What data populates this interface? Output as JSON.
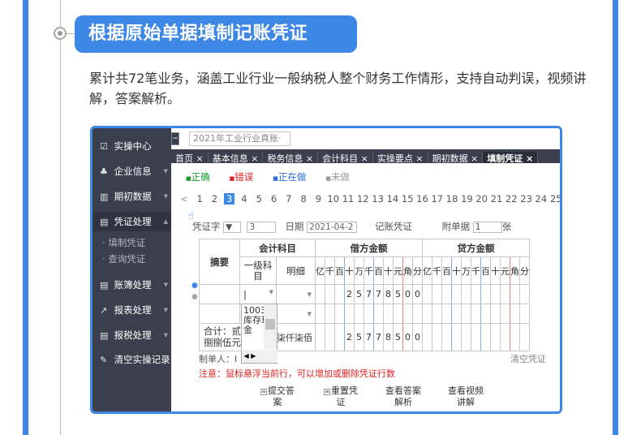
{
  "section_title": "根据原始单据填制记账凭证",
  "description": "累计共72笔业务，涵盖工业行业一般纳税人整个财务工作情形，支持自动判误，视频讲解，答案解析。",
  "colors": {
    "accent": "#3d88e6",
    "sidebar": "#3a3f4d",
    "error": "#e02020"
  },
  "app": {
    "company_select": "2021年工业行业真账·",
    "nav": {
      "items": [
        {
          "icon": "monitor-icon",
          "glyph": "☑",
          "label": "实操中心"
        },
        {
          "icon": "company-icon",
          "glyph": "♣",
          "label": "企业信息"
        },
        {
          "icon": "chart-icon",
          "glyph": "▥",
          "label": "期初数据"
        },
        {
          "icon": "voucher-icon",
          "glyph": "▤",
          "label": "凭证处理"
        },
        {
          "icon": "ledger-icon",
          "glyph": "▤",
          "label": "账簿处理"
        },
        {
          "icon": "report-icon",
          "glyph": "↗",
          "label": "报表处理"
        },
        {
          "icon": "tax-icon",
          "glyph": "▤",
          "label": "报税处理"
        },
        {
          "icon": "broom-icon",
          "glyph": "✎",
          "label": "清空实操记录"
        }
      ],
      "sub_items": [
        "填制凭证",
        "查询凭证"
      ]
    },
    "tabs": [
      "首页 ×",
      "基本信息 ×",
      "税务信息 ×",
      "会计科目 ×",
      "实操要点 ×",
      "期初数据 ×",
      "填制凭证 ×"
    ],
    "legend": [
      {
        "mark": "■",
        "label": "正确",
        "color": "#1a9a2a"
      },
      {
        "mark": "■",
        "label": "错误",
        "color": "#e02020"
      },
      {
        "mark": "■",
        "label": "正在做",
        "color": "#2a6fdb"
      },
      {
        "mark": "■",
        "label": "未做",
        "color": "#999999"
      }
    ],
    "pager": {
      "prev": "<",
      "pages": [
        "1",
        "2",
        "3",
        "4",
        "5",
        "6",
        "7",
        "8",
        "9",
        "10",
        "11",
        "12",
        "13",
        "14",
        "15",
        "16",
        "17",
        "18",
        "19",
        "20",
        "21",
        "22",
        "23",
        "24",
        "25"
      ],
      "current": "3"
    },
    "voucher": {
      "word_label": "凭证字",
      "word_arrow": "▼",
      "number": "3",
      "date_label": "日期",
      "date_value": "2021-04-2",
      "title": "记账凭证",
      "attach_label": "附单据",
      "attach_value": "1",
      "attach_unit": "张",
      "col_summary": "摘要",
      "col_account": "会计科目",
      "col_level1": "一级科目",
      "col_detail": "明细",
      "col_debit": "借方金额",
      "col_credit": "贷方金额",
      "digit_units": [
        "亿",
        "千",
        "百",
        "十",
        "万",
        "千",
        "百",
        "十",
        "元",
        "角",
        "分"
      ],
      "row1_debit_digits": [
        "",
        "",
        "",
        "2",
        "5",
        "7",
        "7",
        "8",
        "5",
        "0",
        "0"
      ],
      "total_debit_digits": [
        "",
        "",
        "",
        "2",
        "5",
        "7",
        "7",
        "8",
        "5",
        "0",
        "0"
      ],
      "dropdown_text": "1003-库存现金",
      "total_label": "合计：贰捌捌伍元",
      "total_words_right": "柒仟柒佰",
      "maker_label": "制单人：I",
      "clear_label": "清空凭证",
      "notice": "注意：鼠标悬浮当前行，可以增加或删除凭证行数"
    },
    "buttons": [
      "提交答案",
      "重置凭证",
      "查看答案解析",
      "查看视频讲解"
    ]
  }
}
